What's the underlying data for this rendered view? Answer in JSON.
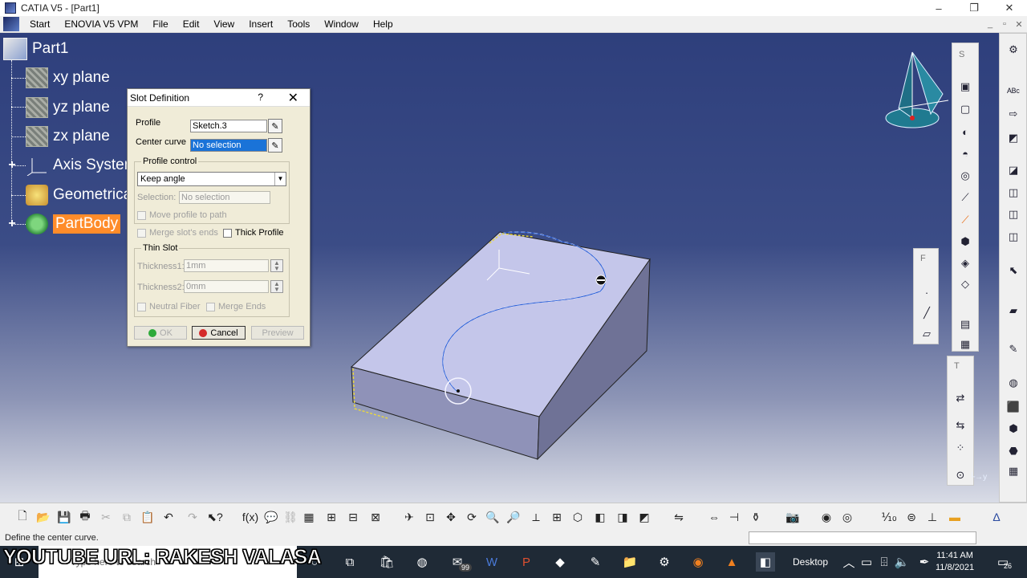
{
  "window": {
    "title": "CATIA V5 - [Part1]",
    "controls": [
      "–",
      "❐",
      "✕"
    ]
  },
  "menubar": {
    "items": [
      "Start",
      "ENOVIA V5 VPM",
      "File",
      "Edit",
      "View",
      "Insert",
      "Tools",
      "Window",
      "Help"
    ],
    "doc_controls": [
      "_",
      "▫",
      "✕"
    ]
  },
  "tree": {
    "root": "Part1",
    "nodes": [
      "xy plane",
      "yz plane",
      "zx plane",
      "Axis System",
      "Geometrical",
      "PartBody"
    ]
  },
  "dialog": {
    "title": "Slot Definition",
    "help": "?",
    "close": "✕",
    "profile_label": "Profile",
    "profile_value": "Sketch.3",
    "center_curve_label": "Center curve",
    "center_curve_value": "No selection",
    "profile_control_title": "Profile control",
    "profile_control_value": "Keep angle",
    "selection_label": "Selection:",
    "selection_value": "No selection",
    "move_profile": "Move profile to path",
    "merge_slot_ends": "Merge slot's ends",
    "thick_profile": "Thick Profile",
    "thin_slot_title": "Thin Slot",
    "thickness1_label": "Thickness1:",
    "thickness1_value": "1mm",
    "thickness2_label": "Thickness2:",
    "thickness2_value": "0mm",
    "neutral_fiber": "Neutral Fiber",
    "merge_ends": "Merge Ends",
    "ok": "OK",
    "cancel": "Cancel",
    "preview": "Preview"
  },
  "toolbars": {
    "sketch_caption": "S",
    "f_caption": "F",
    "t_caption": "T"
  },
  "statusbar": {
    "message": "Define the center curve."
  },
  "taskbar": {
    "search_placeholder": "Type here to search",
    "desktop_label": "Desktop",
    "time": "11:41 AM",
    "date": "11/8/2021",
    "mail_badge": "99",
    "notif_badge": "26"
  },
  "overlay": {
    "text": "YOUTUBE URL: RAKESH VALASA"
  },
  "colors": {
    "selected_node": "#ff8c2a",
    "highlight_field": "#1a73d8",
    "viewport_top": "#2e3f7c"
  }
}
